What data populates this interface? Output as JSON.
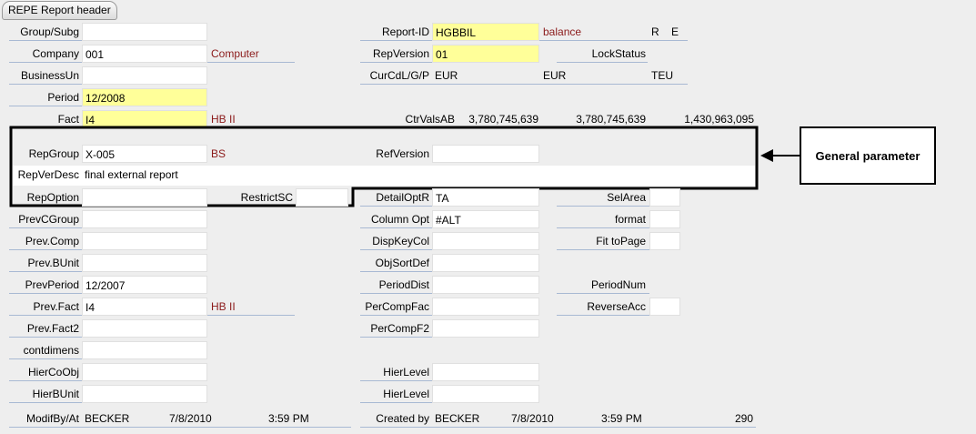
{
  "tab": "REPE Report header",
  "left": {
    "group_subg": {
      "label": "Group/Subg",
      "value": ""
    },
    "company": {
      "label": "Company",
      "value": "001",
      "desc": "Computer"
    },
    "business_unit": {
      "label": "BusinessUn",
      "value": ""
    },
    "period": {
      "label": "Period",
      "value": "12/2008"
    },
    "fact": {
      "label": "Fact",
      "value": "I4",
      "desc": "HB II"
    },
    "rep_group": {
      "label": "RepGroup",
      "value": "X-005",
      "desc": "BS"
    },
    "rep_ver_desc": {
      "label": "RepVerDesc",
      "value": "final external report"
    },
    "rep_option": {
      "label": "RepOption",
      "value": ""
    },
    "restrict_sc": {
      "label": "RestrictSC",
      "value": ""
    },
    "prev_cgroup": {
      "label": "PrevCGroup",
      "value": ""
    },
    "prev_comp": {
      "label": "Prev.Comp",
      "value": ""
    },
    "prev_bunit": {
      "label": "Prev.BUnit",
      "value": ""
    },
    "prev_period": {
      "label": "PrevPeriod",
      "value": "12/2007"
    },
    "prev_fact": {
      "label": "Prev.Fact",
      "value": "I4",
      "desc": "HB II"
    },
    "prev_fact2": {
      "label": "Prev.Fact2",
      "value": ""
    },
    "contdimens": {
      "label": "contdimens",
      "value": ""
    },
    "hier_co_obj": {
      "label": "HierCoObj",
      "value": ""
    },
    "hier_bunit": {
      "label": "HierBUnit",
      "value": ""
    },
    "modified": {
      "label": "ModifBy/At",
      "user": "BECKER",
      "date": "7/8/2010",
      "time": "3:59 PM"
    }
  },
  "right": {
    "report_id": {
      "label": "Report-ID",
      "value": "HGBBIL",
      "desc": "balance",
      "flag1": "R",
      "flag2": "E"
    },
    "rep_version": {
      "label": "RepVersion",
      "value": "01"
    },
    "lock_status": {
      "label": "LockStatus",
      "value": ""
    },
    "cur": {
      "label": "CurCdL/G/P",
      "c1": "EUR",
      "c2": "EUR",
      "c3": "TEU"
    },
    "ctr_vals": {
      "label": "CtrValsAB",
      "v1": "3,780,745,639",
      "v2": "3,780,745,639",
      "v3": "1,430,963,095"
    },
    "ref_version": {
      "label": "RefVersion",
      "value": ""
    },
    "detail_optr": {
      "label": "DetailOptR",
      "value": "TA"
    },
    "sel_area": {
      "label": "SelArea",
      "value": ""
    },
    "column_opt": {
      "label": "Column Opt",
      "value": "#ALT"
    },
    "format": {
      "label": "format",
      "value": ""
    },
    "disp_key_col": {
      "label": "DispKeyCol",
      "value": ""
    },
    "fit_to_page": {
      "label": "Fit toPage",
      "value": ""
    },
    "obj_sort_def": {
      "label": "ObjSortDef",
      "value": ""
    },
    "period_dist": {
      "label": "PeriodDist",
      "value": ""
    },
    "period_num": {
      "label": "PeriodNum",
      "value": ""
    },
    "per_comp_fac": {
      "label": "PerCompFac",
      "value": ""
    },
    "reverse_acc": {
      "label": "ReverseAcc",
      "value": ""
    },
    "per_comp_f2": {
      "label": "PerCompF2",
      "value": ""
    },
    "hier_level_1": {
      "label": "HierLevel",
      "value": ""
    },
    "hier_level_2": {
      "label": "HierLevel",
      "value": ""
    },
    "created": {
      "label": "Created by",
      "user": "BECKER",
      "date": "7/8/2010",
      "time": "3:59 PM",
      "number": "290"
    }
  },
  "callout": "General parameter"
}
